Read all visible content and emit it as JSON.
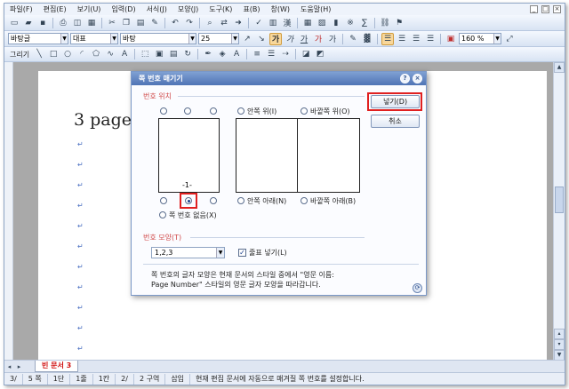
{
  "menu": {
    "items": [
      "파일(F)",
      "편집(E)",
      "보기(U)",
      "입력(D)",
      "서식(J)",
      "모양(J)",
      "도구(K)",
      "표(B)",
      "창(W)",
      "도움말(H)"
    ],
    "window_controls": [
      "_",
      "□",
      "×"
    ]
  },
  "toolbar2": {
    "style": "바탕글",
    "language": "대표",
    "font": "바탕",
    "size": "25",
    "zoom": "160 %"
  },
  "toolbar3": {
    "draw": "그리기"
  },
  "document": {
    "heading": "3  page",
    "para_mark": "↵"
  },
  "tabs": {
    "doc_tab": "빈 문서 3"
  },
  "status": [
    "3/",
    "5 쪽",
    "1단",
    "1줄",
    "1칸",
    "2/",
    "2 구역",
    "삽입",
    "현재 편집 문서에 자동으로 매겨질 쪽 번호를 설정합니다."
  ],
  "dialog": {
    "title": "쪽 번호 매기기",
    "title_help": "?",
    "title_close": "×",
    "position_label": "번호 위치",
    "page_number_sample": "-1-",
    "options": {
      "inner_top": "안쪽 위(I)",
      "outer_top": "바깥쪽 위(O)",
      "inner_bottom": "안쪽 아래(N)",
      "outer_bottom": "바깥쪽 아래(B)",
      "no_number": "쪽 번호 없음(X)"
    },
    "format_label": "번호 모양(T)",
    "format_value": "1,2,3",
    "decoration_checkbox": "줄표 넣기(L)",
    "decoration_checked": true,
    "note_line1": "쪽 번호의 글자 모양은 현재 문서의 스타일 중에서 \"영문 이름:",
    "note_line2": "Page Number\" 스타일의 영문 글자 모양을 따라갑니다.",
    "ok_button": "넣기(D)",
    "cancel_button": "취소"
  },
  "colors": {
    "highlight_red": "#e02020",
    "dialog_title_bg": "#4f74b5",
    "para_mark": "#4a6fc2"
  }
}
